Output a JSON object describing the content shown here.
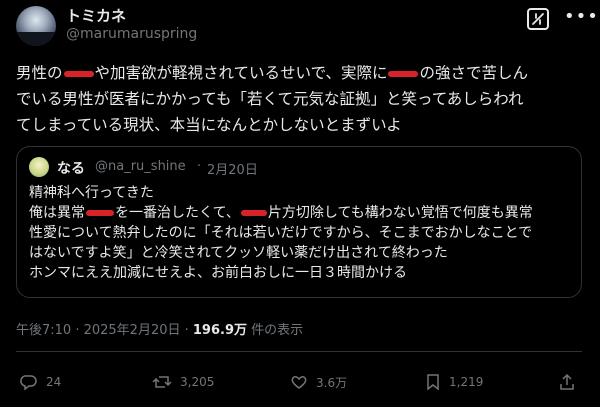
{
  "author": {
    "name": "トミカネ",
    "handle": "@marumaruspring"
  },
  "post": {
    "line1_a": "男性の",
    "line1_b": "や加害欲が軽視されているせいで、実際に",
    "line1_c": "の強さで苦しん",
    "line2": "でいる男性が医者にかかっても「若くて元気な証拠」と笑ってあしらわれ",
    "line3": "てしまっている現状、本当になんとかしないとまずいよ"
  },
  "quote": {
    "name": "なる",
    "handle": "@na_ru_shine",
    "separator": "·",
    "date": "2月20日",
    "line1": "精神科へ行ってきた",
    "line2_a": "俺は異常",
    "line2_b": "を一番治したくて、",
    "line2_c": "片方切除しても構わない覚悟で何度も異常",
    "line3": "性愛について熱弁したのに「それは若いだけですから、そこまでおかしなことで",
    "line4": "はないですよ笑」と冷笑されてクッソ軽い薬だけ出されて終わった",
    "line5": "ホンマにええ加減にせえよ、お前白おしに一日３時間かける"
  },
  "meta": {
    "time": "午後7:10 · 2025年2月20日 · ",
    "views_count": "196.9万",
    "views_label": " 件の表示"
  },
  "actions": {
    "replies": "24",
    "reposts": "3,205",
    "likes": "3.6万",
    "bookmarks": "1,219"
  },
  "colors": {
    "background": "#000000",
    "text": "#e7e9ea",
    "muted": "#71767b",
    "redaction": "#d9232a",
    "border": "#2f3336"
  },
  "icons": [
    "grok-icon",
    "more-icon",
    "reply-icon",
    "repost-icon",
    "like-icon",
    "bookmark-icon",
    "share-icon"
  ]
}
